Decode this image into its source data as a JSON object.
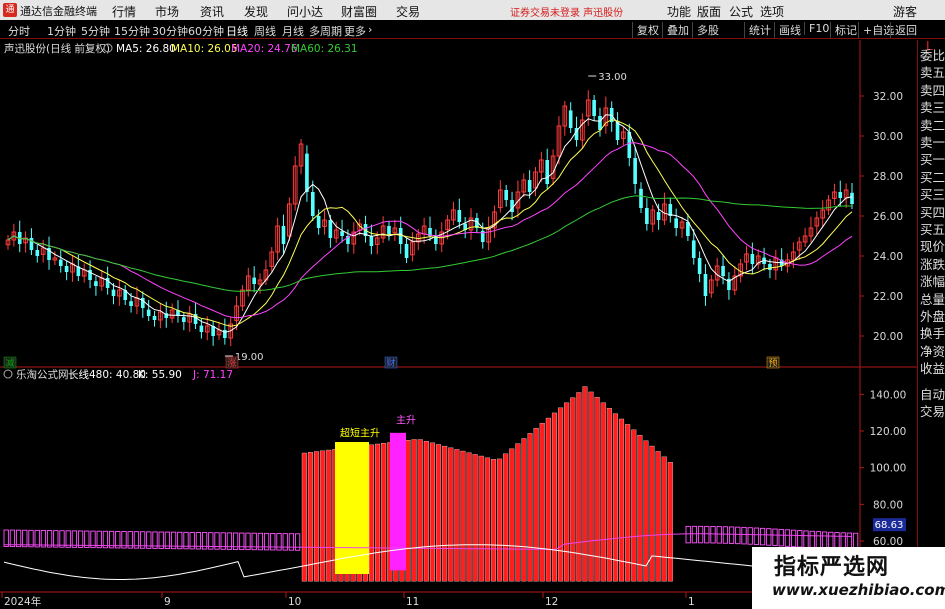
{
  "app": {
    "title": "通达信金融终端",
    "menus": [
      "行情",
      "市场",
      "资讯",
      "发现",
      "问小达",
      "财富圈",
      "交易"
    ],
    "warning": "证券交易未登录 声迅股份",
    "right_menus": [
      "功能",
      "版面",
      "公式",
      "选项"
    ],
    "guest": "游客"
  },
  "periods": {
    "tabs": [
      "分时",
      "1分钟",
      "5分钟",
      "15分钟",
      "30分钟",
      "60分钟",
      "日线",
      "周线",
      "月线",
      "多周期",
      "更多"
    ],
    "active": "日线",
    "tools": [
      "复权",
      "叠加",
      "多股",
      "统计",
      "画线",
      "F10",
      "标记",
      "+自选",
      "返回"
    ]
  },
  "side_panel": {
    "top": "L",
    "items": [
      "委比",
      "卖五",
      "卖四",
      "卖三",
      "卖二",
      "卖一",
      "买一",
      "买二",
      "买三",
      "买四",
      "买五",
      "现价",
      "涨跌",
      "涨幅",
      "总量",
      "外盘",
      "换手",
      "净资",
      "收益",
      "自动",
      "交易"
    ]
  },
  "colors": {
    "up": "#ff3c3c",
    "down": "#55ffff",
    "ma5": "#ffffff",
    "ma10": "#ffff55",
    "ma20": "#ff44ff",
    "ma60": "#33cc33",
    "axis": "#b01818",
    "yellow_bar": "#ffff00",
    "magenta_bar": "#ff22ff"
  },
  "chart_data": [
    {
      "type": "candlestick",
      "title": "声迅股份(日线 前复权)",
      "legend": [
        {
          "name": "MA5",
          "value": "26.80"
        },
        {
          "name": "MA10",
          "value": "26.05"
        },
        {
          "name": "MA20",
          "value": "24.76"
        },
        {
          "name": "MA60",
          "value": "26.31"
        }
      ],
      "yticks": [
        "32.00",
        "30.00",
        "28.00",
        "26.00",
        "24.00",
        "22.00",
        "20.00"
      ],
      "ylim": [
        19.0,
        34.0
      ],
      "annotations": {
        "high": "33.00",
        "low": "19.00"
      },
      "markers": [
        "减",
        "涨",
        "财",
        "预"
      ],
      "closes": [
        24.8,
        25.2,
        24.6,
        24.9,
        24.3,
        24.0,
        24.4,
        23.8,
        23.9,
        23.5,
        23.2,
        23.6,
        23.0,
        23.3,
        22.8,
        22.5,
        22.9,
        22.4,
        22.0,
        22.3,
        21.8,
        21.5,
        21.9,
        21.4,
        21.0,
        20.8,
        21.2,
        20.9,
        21.3,
        21.0,
        20.7,
        21.1,
        20.6,
        20.2,
        20.5,
        20.0,
        20.3,
        19.9,
        20.6,
        21.5,
        22.3,
        23.0,
        22.6,
        22.8,
        23.3,
        24.2,
        25.5,
        24.6,
        26.6,
        28.5,
        29.6,
        27.2,
        26.0,
        25.4,
        25.8,
        24.9,
        25.3,
        25.0,
        24.6,
        25.2,
        25.6,
        25.0,
        24.5,
        24.9,
        25.5,
        25.1,
        25.4,
        24.6,
        23.9,
        24.7,
        25.1,
        25.5,
        25.0,
        24.6,
        25.2,
        25.8,
        26.3,
        25.7,
        25.3,
        25.9,
        25.4,
        24.7,
        25.4,
        26.2,
        27.3,
        26.8,
        26.2,
        27.2,
        27.8,
        27.2,
        28.2,
        28.8,
        27.6,
        29.0,
        30.5,
        31.5,
        30.4,
        29.8,
        30.8,
        31.8,
        31.0,
        30.3,
        31.4,
        30.7,
        29.8,
        30.2,
        28.9,
        27.6,
        26.4,
        25.6,
        26.3,
        25.8,
        26.6,
        26.0,
        25.4,
        25.7,
        25.0,
        23.9,
        23.1,
        22.0,
        22.8,
        23.5,
        23.0,
        22.3,
        23.0,
        23.6,
        24.1,
        23.6,
        24.0,
        23.6,
        23.3,
        23.9,
        23.5,
        23.8,
        24.2,
        24.7,
        25.0,
        25.4,
        25.9,
        26.3,
        26.8,
        27.2,
        26.9,
        27.3,
        26.6
      ]
    },
    {
      "type": "indicator",
      "title": "乐淘公式网",
      "legend": [
        {
          "name": "长线480",
          "value": "40.80"
        },
        {
          "name": "K",
          "value": "55.90"
        },
        {
          "name": "J",
          "value": "71.17"
        }
      ],
      "yticks": [
        "140.00",
        "120.00",
        "100.00",
        "80.00",
        "60.00",
        "40.00"
      ],
      "ylim": [
        36,
        150
      ],
      "current_label": "68.63",
      "labels": [
        "超短主升",
        "主升"
      ],
      "x_labels": [
        "2024年",
        "9",
        "10",
        "11",
        "12",
        "1"
      ]
    }
  ],
  "watermark": {
    "title": "指标严选网",
    "url": "www.xuezhibiao.com"
  }
}
